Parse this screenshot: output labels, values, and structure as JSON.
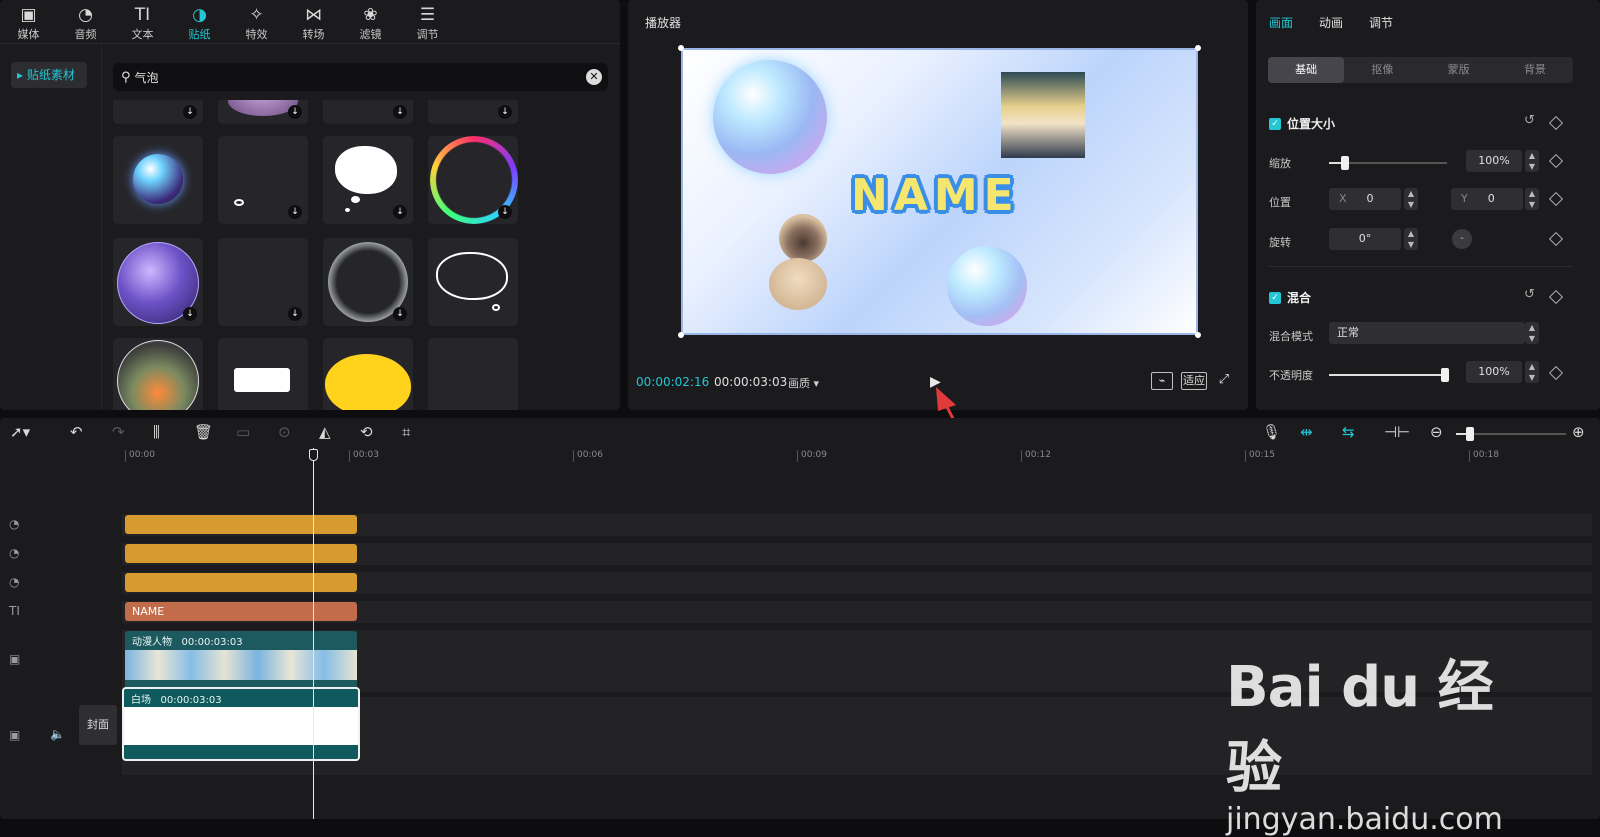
{
  "top_tabs": [
    {
      "label": "媒体",
      "icon": "media-icon",
      "glyph": "▣"
    },
    {
      "label": "音频",
      "icon": "audio-icon",
      "glyph": "◔"
    },
    {
      "label": "文本",
      "icon": "text-icon",
      "glyph": "TI"
    },
    {
      "label": "贴纸",
      "icon": "sticker-icon",
      "glyph": "◑"
    },
    {
      "label": "特效",
      "icon": "effects-icon",
      "glyph": "✧"
    },
    {
      "label": "转场",
      "icon": "transition-icon",
      "glyph": "⋈"
    },
    {
      "label": "滤镜",
      "icon": "filter-icon",
      "glyph": "❀"
    },
    {
      "label": "调节",
      "icon": "adjust-icon",
      "glyph": "☰"
    }
  ],
  "active_tab": "贴纸",
  "sidebar": {
    "item": "贴纸素材"
  },
  "search": {
    "value": "气泡"
  },
  "player": {
    "title": "播放器",
    "preview_text": "NAME",
    "current_time": "00:00:02:16",
    "total_time": "00:00:03:03",
    "quality": "画质",
    "fit_label": "适应"
  },
  "props": {
    "tabs": [
      "画面",
      "动画",
      "调节"
    ],
    "active_tab": "画面",
    "segments": [
      "基础",
      "抠像",
      "蒙版",
      "背景"
    ],
    "active_segment": "基础",
    "section_position": "位置大小",
    "scale_label": "缩放",
    "scale_value": "100%",
    "scale_level": 0.15,
    "position_label": "位置",
    "x_label": "X",
    "x_value": "0",
    "y_label": "Y",
    "y_value": "0",
    "rotate_label": "旋转",
    "rotate_value": "0°",
    "section_blend": "混合",
    "blend_mode_label": "混合模式",
    "blend_mode_value": "正常",
    "opacity_label": "不透明度",
    "opacity_value": "100%",
    "opacity_level": 1.0
  },
  "timeline": {
    "ruler": [
      "00:00",
      "00:03",
      "00:06",
      "00:09",
      "00:12",
      "00:15",
      "00:18"
    ],
    "text_clip": "NAME",
    "video_clip_name": "动漫人物",
    "video_clip_duration": "00:00:03:03",
    "main_clip_name": "白场",
    "main_clip_duration": "00:00:03:03",
    "cover_label": "封面"
  },
  "watermark": {
    "logo": "Bai du 经验",
    "url": "jingyan.baidu.com"
  },
  "colors": {
    "accent": "#23c6d2",
    "clip_orange": "#d69a2f",
    "clip_text": "#c26c4c",
    "clip_video": "#1d5a5f"
  }
}
